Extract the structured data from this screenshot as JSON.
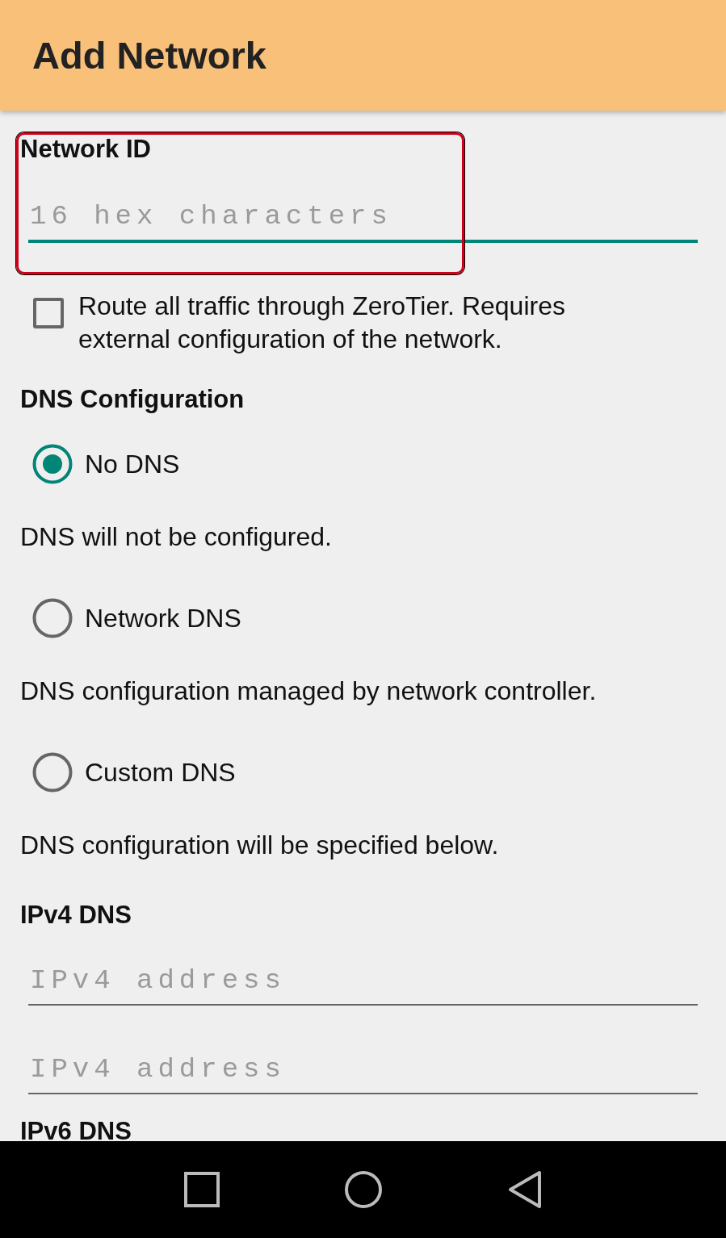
{
  "app_bar": {
    "title": "Add Network"
  },
  "network_id": {
    "label": "Network ID",
    "placeholder": "16 hex characters",
    "focused": true,
    "highlighted": true
  },
  "route_all": {
    "label": "Route all traffic through ZeroTier. Requires external configuration of the network.",
    "checked": false
  },
  "dns": {
    "heading": "DNS Configuration",
    "options": [
      {
        "label": "No DNS",
        "description": "DNS will not be configured.",
        "selected": true
      },
      {
        "label": "Network DNS",
        "description": "DNS configuration managed by network controller.",
        "selected": false
      },
      {
        "label": "Custom DNS",
        "description": "DNS configuration will be specified below.",
        "selected": false
      }
    ]
  },
  "ipv4": {
    "heading": "IPv4 DNS",
    "fields": [
      {
        "placeholder": "IPv4 address"
      },
      {
        "placeholder": "IPv4 address"
      }
    ]
  },
  "ipv6": {
    "heading": "IPv6 DNS"
  },
  "nav_bar": {
    "buttons": [
      {
        "kind": "recents"
      },
      {
        "kind": "home"
      },
      {
        "kind": "back"
      }
    ]
  }
}
